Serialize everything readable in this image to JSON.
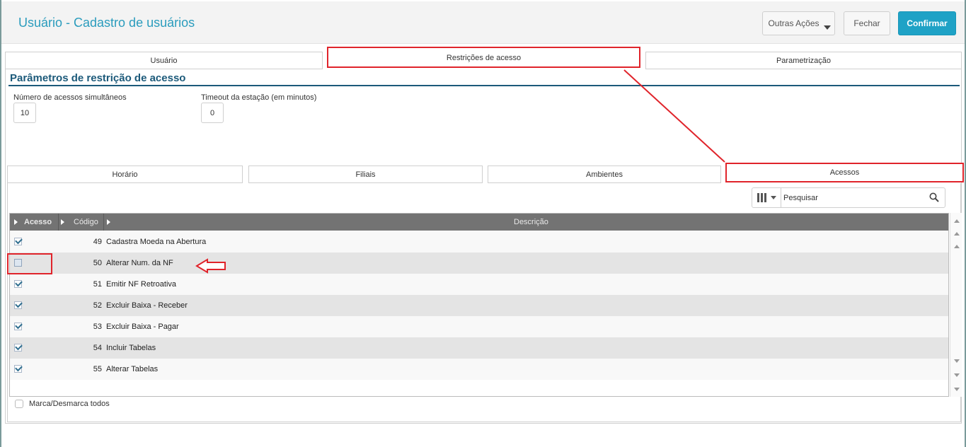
{
  "header": {
    "title": "Usuário - Cadastro de usuários",
    "outras_acoes": "Outras Ações",
    "fechar": "Fechar",
    "confirmar": "Confirmar"
  },
  "main_tabs": [
    {
      "label": "Usuário"
    },
    {
      "label": "Restrições de acesso",
      "active": true
    },
    {
      "label": "Parametrização"
    }
  ],
  "section": {
    "title": "Parâmetros de restrição de acesso",
    "fields": [
      {
        "label": "Número de acessos simultâneos",
        "value": "10"
      },
      {
        "label": "Timeout da estação (em minutos)",
        "value": "0"
      }
    ]
  },
  "sub_tabs": [
    {
      "label": "Horário"
    },
    {
      "label": "Filiais"
    },
    {
      "label": "Ambientes"
    },
    {
      "label": "Acessos",
      "active": true
    }
  ],
  "search": {
    "placeholder": "Pesquisar"
  },
  "grid": {
    "columns": [
      "Acesso",
      "Código",
      "Descrição"
    ],
    "rows": [
      {
        "checked": true,
        "code": "49",
        "desc": "Cadastra Moeda na Abertura"
      },
      {
        "checked": false,
        "code": "50",
        "desc": "Alterar Num. da NF"
      },
      {
        "checked": true,
        "code": "51",
        "desc": "Emitir NF Retroativa"
      },
      {
        "checked": true,
        "code": "52",
        "desc": "Excluir Baixa - Receber"
      },
      {
        "checked": true,
        "code": "53",
        "desc": "Excluir Baixa - Pagar"
      },
      {
        "checked": true,
        "code": "54",
        "desc": "Incluir Tabelas"
      },
      {
        "checked": true,
        "code": "55",
        "desc": "Alterar Tabelas"
      }
    ]
  },
  "footer": {
    "marca_label": "Marca/Desmarca todos"
  },
  "colors": {
    "accent": "#2a9cbd",
    "primary_button": "#1fa2c6",
    "annotation": "#e0242b",
    "section_title": "#1c5a7a"
  }
}
